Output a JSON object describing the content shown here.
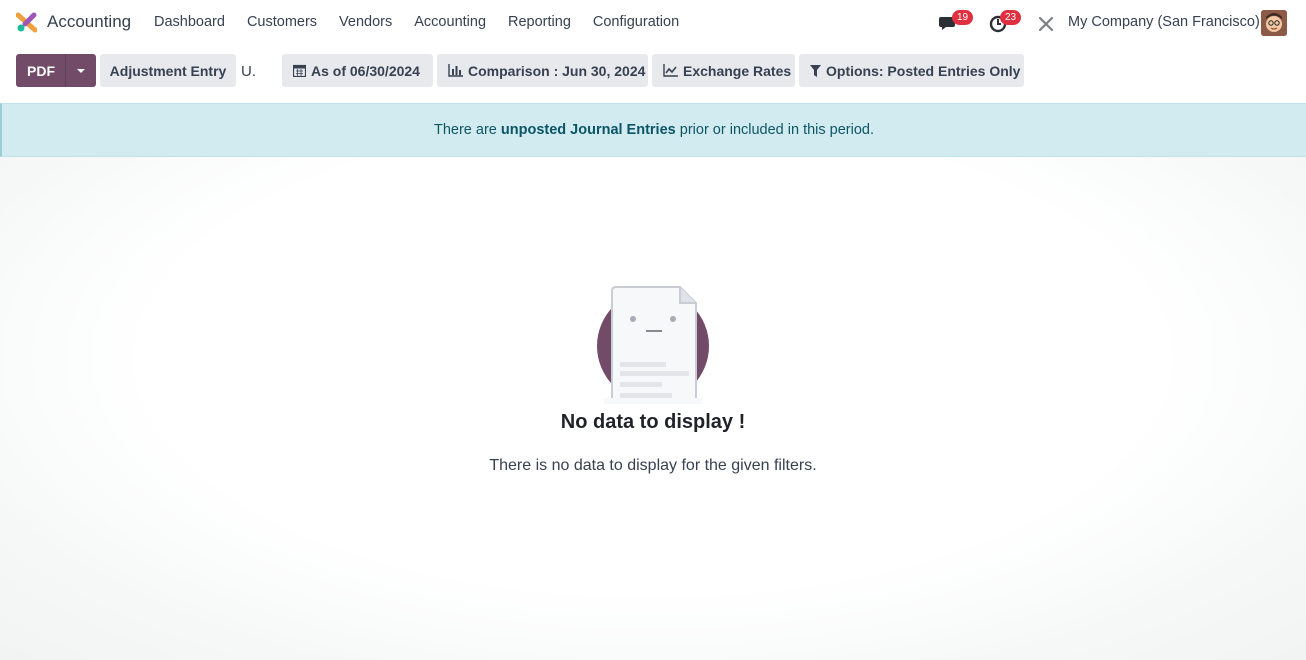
{
  "navbar": {
    "app_name": "Accounting",
    "menu": [
      "Dashboard",
      "Customers",
      "Vendors",
      "Accounting",
      "Reporting",
      "Configuration"
    ],
    "messages_count": "19",
    "activities_count": "23",
    "company": "My Company (San Francisco)"
  },
  "control_panel": {
    "pdf_label": "PDF",
    "adjustment_label": "Adjustment Entry",
    "loose_text": "U.",
    "date_filter": "As of 06/30/2024",
    "comparison_filter": "Comparison : Jun 30, 2024",
    "exchange_rates": "Exchange Rates",
    "options_filter": "Options: Posted Entries Only"
  },
  "alert": {
    "prefix": "There are ",
    "link": "unposted Journal Entries",
    "suffix": " prior or included in this period."
  },
  "empty_state": {
    "title": "No data to display !",
    "text": "There is no data to display for the given filters."
  },
  "colors": {
    "brand": "#714b67",
    "alert_bg": "#d1ebf0",
    "badge": "#e03040"
  }
}
